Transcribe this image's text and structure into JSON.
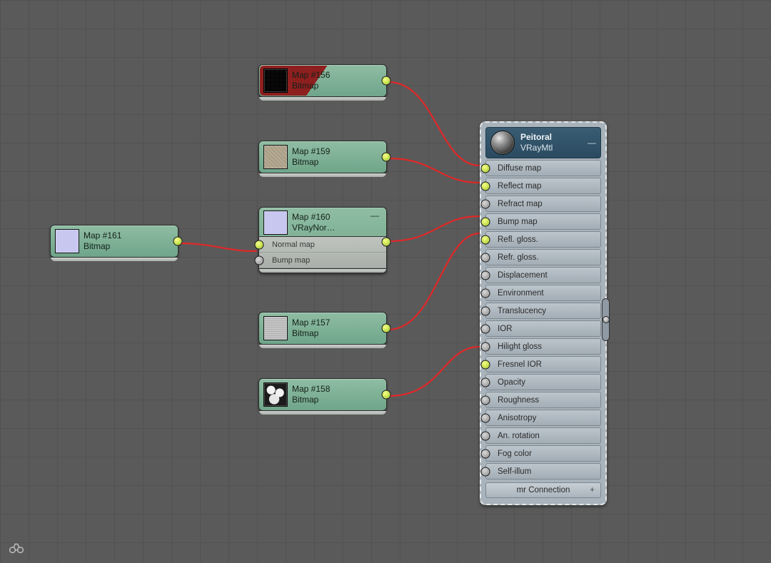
{
  "nodes": {
    "n161": {
      "title": "Map #161",
      "type": "Bitmap"
    },
    "n156": {
      "title": "Map #156",
      "type": "Bitmap"
    },
    "n159": {
      "title": "Map #159",
      "type": "Bitmap"
    },
    "n160": {
      "title": "Map #160",
      "type": "VRayNor…",
      "slots": [
        "Normal map",
        "Bump map"
      ]
    },
    "n157": {
      "title": "Map #157",
      "type": "Bitmap"
    },
    "n158": {
      "title": "Map #158",
      "type": "Bitmap"
    }
  },
  "material": {
    "title": "Peitoral",
    "type": "VRayMtl",
    "slots": [
      {
        "label": "Diffuse map",
        "connected": true
      },
      {
        "label": "Reflect map",
        "connected": true
      },
      {
        "label": "Refract map",
        "connected": false
      },
      {
        "label": "Bump map",
        "connected": true
      },
      {
        "label": "Refl. gloss.",
        "connected": true
      },
      {
        "label": "Refr. gloss.",
        "connected": false
      },
      {
        "label": "Displacement",
        "connected": false
      },
      {
        "label": "Environment",
        "connected": false
      },
      {
        "label": "Translucency",
        "connected": false
      },
      {
        "label": "IOR",
        "connected": false
      },
      {
        "label": "Hilight gloss",
        "connected": false
      },
      {
        "label": "Fresnel IOR",
        "connected": true
      },
      {
        "label": "Opacity",
        "connected": false
      },
      {
        "label": "Roughness",
        "connected": false
      },
      {
        "label": "Anisotropy",
        "connected": false
      },
      {
        "label": "An. rotation",
        "connected": false
      },
      {
        "label": "Fog color",
        "connected": false
      },
      {
        "label": "Self-illum",
        "connected": false
      }
    ],
    "footer": "mr Connection"
  },
  "collapse_glyph": "—"
}
